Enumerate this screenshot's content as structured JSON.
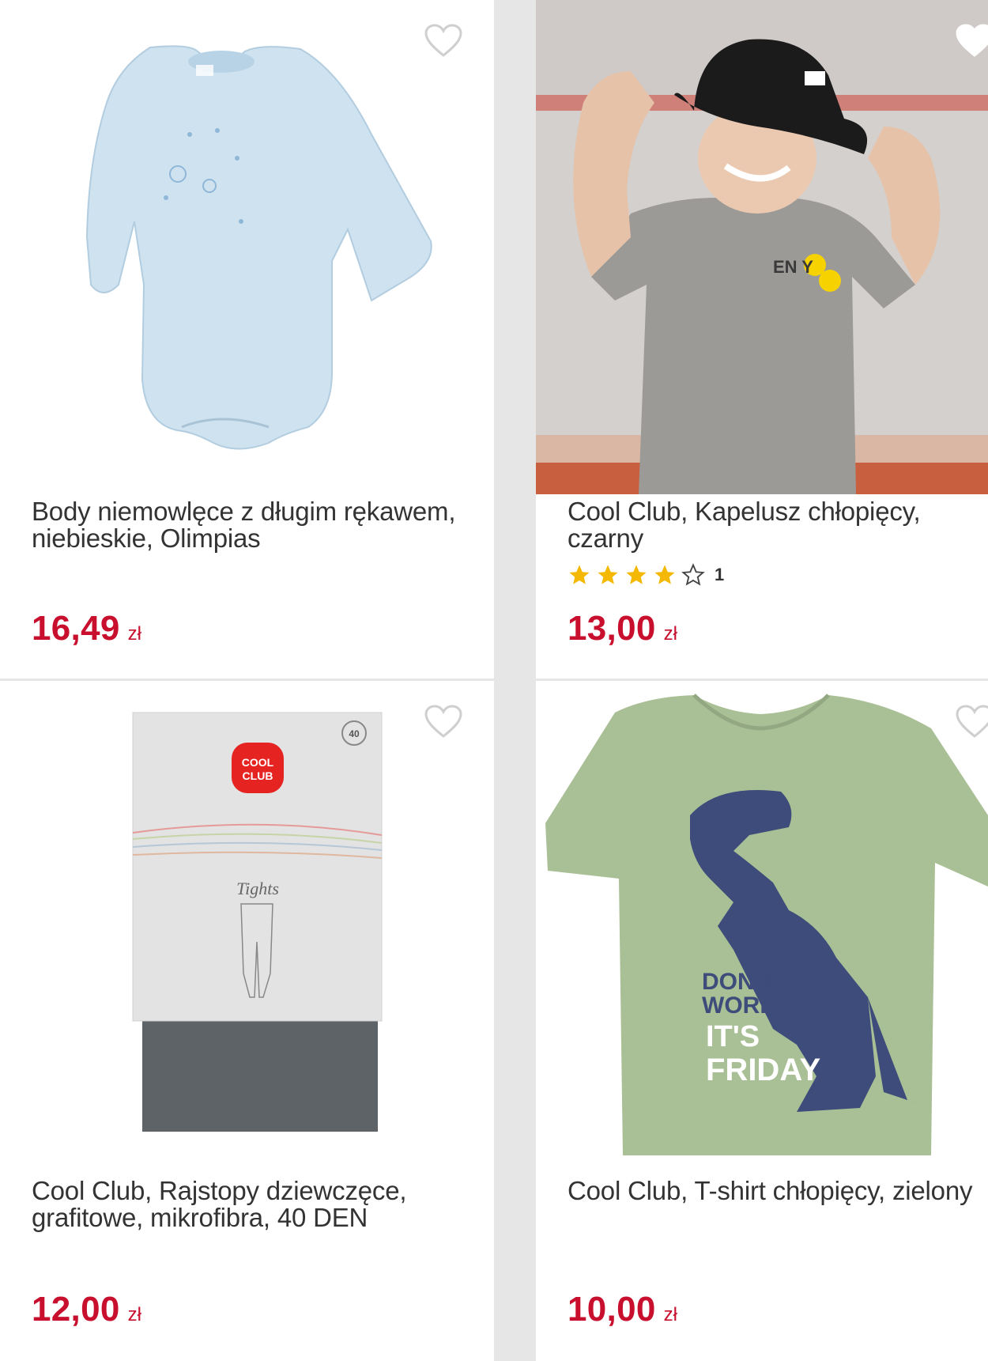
{
  "colors": {
    "price": "#c8102e",
    "title": "#333333",
    "star": "#f5b800",
    "divider": "#e6e6e6"
  },
  "products": [
    {
      "title": "Body niemowlęce z długim rękawem, niebieskie, Olimpias",
      "price": "16,49",
      "currency": "zł",
      "favorite_icon": "heart-outline-icon"
    },
    {
      "title": "Cool Club, Kapelusz chłopięcy, czarny",
      "rating": 4,
      "rating_max": 5,
      "rating_count": "1",
      "price": "13,00",
      "currency": "zł",
      "favorite_icon": "heart-outline-icon"
    },
    {
      "title": "Cool Club, Rajstopy dziewczęce, grafitowe, mikrofibra, 40 DEN",
      "price": "12,00",
      "currency": "zł",
      "favorite_icon": "heart-outline-icon"
    },
    {
      "title": "Cool Club, T-shirt chłopięcy, zielony",
      "price": "10,00",
      "currency": "zł",
      "favorite_icon": "heart-outline-icon"
    }
  ],
  "image_text": {
    "package_brand_line1": "COOL",
    "package_brand_line2": "CLUB",
    "package_den": "40",
    "package_label": "Tights",
    "shirt_print_1": "DON'T",
    "shirt_print_2": "WORRY",
    "shirt_print_3": "IT'S",
    "shirt_print_4": "FRIDAY"
  }
}
